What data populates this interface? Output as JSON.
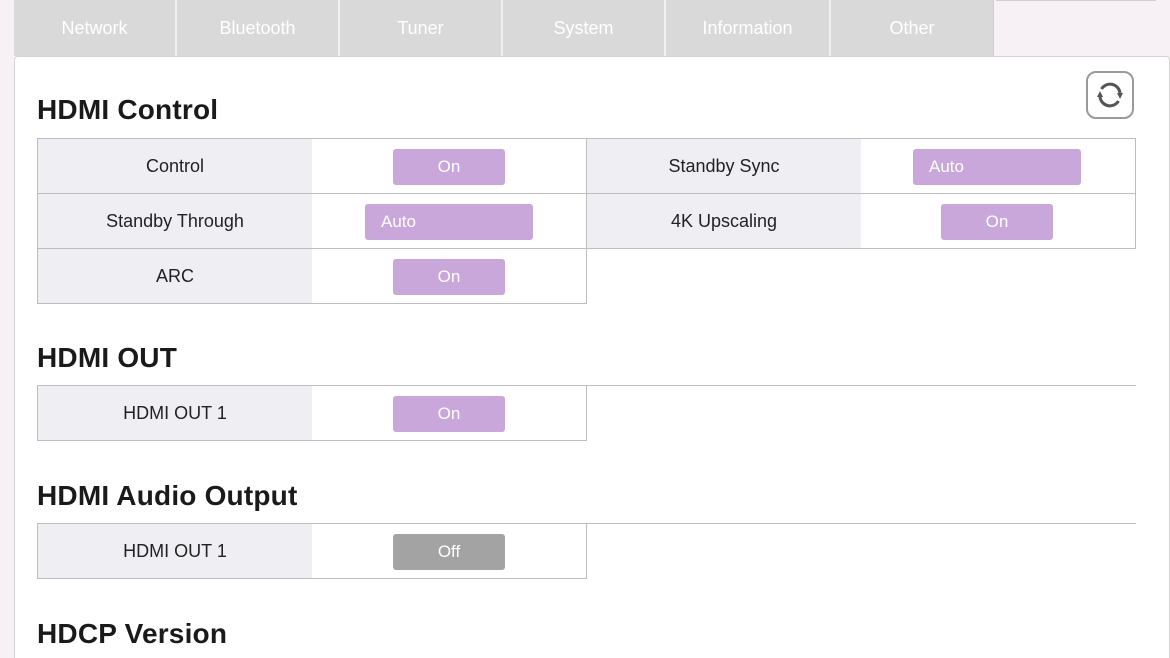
{
  "tabs": [
    "Network",
    "Bluetooth",
    "Tuner",
    "System",
    "Information",
    "Other"
  ],
  "sections": {
    "hdmi_control": {
      "title": "HDMI Control",
      "control_label": "Control",
      "control_value": "On",
      "standby_sync_label": "Standby Sync",
      "standby_sync_value": "Auto",
      "standby_through_label": "Standby Through",
      "standby_through_value": "Auto",
      "upscaling_label": "4K Upscaling",
      "upscaling_value": "On",
      "arc_label": "ARC",
      "arc_value": "On"
    },
    "hdmi_out": {
      "title": "HDMI OUT",
      "out1_label": "HDMI OUT 1",
      "out1_value": "On"
    },
    "hdmi_audio_output": {
      "title": "HDMI Audio Output",
      "out1_label": "HDMI OUT 1",
      "out1_value": "Off"
    },
    "hdcp_version": {
      "title": "HDCP Version"
    }
  },
  "icons": {
    "refresh": "refresh-icon"
  },
  "colors": {
    "toggle_on": "#c9a7db",
    "toggle_off": "#a3a3a3",
    "tab_bg": "#d9d9d9"
  }
}
